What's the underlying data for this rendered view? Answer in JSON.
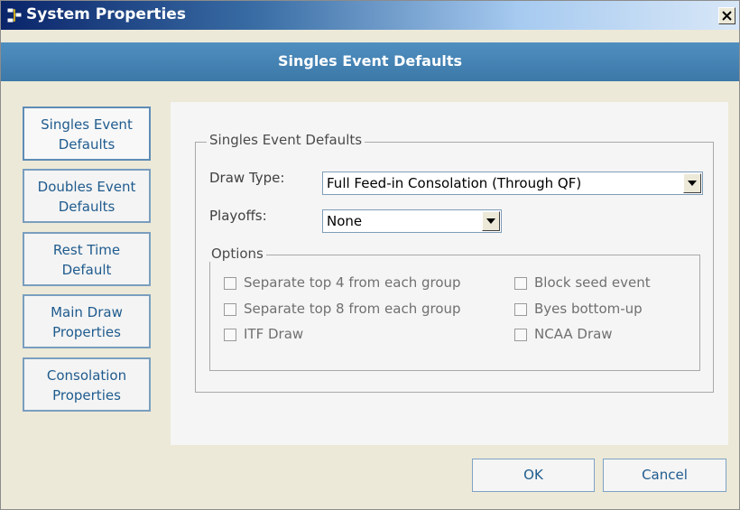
{
  "window": {
    "title": "System Properties",
    "close_symbol": "×"
  },
  "header": {
    "title": "Singles Event Defaults"
  },
  "sidebar": {
    "items": [
      {
        "line1": "Singles Event",
        "line2": "Defaults",
        "active": true
      },
      {
        "line1": "Doubles Event",
        "line2": "Defaults",
        "active": false
      },
      {
        "line1": "Rest Time",
        "line2": "Default",
        "active": false
      },
      {
        "line1": "Main Draw",
        "line2": "Properties",
        "active": false
      },
      {
        "line1": "Consolation",
        "line2": "Properties",
        "active": false
      }
    ]
  },
  "main": {
    "group_title": "Singles Event Defaults",
    "draw_type": {
      "label": "Draw Type:",
      "value": "Full Feed-in Consolation (Through QF)"
    },
    "playoffs": {
      "label": "Playoffs:",
      "value": "None"
    },
    "options": {
      "title": "Options",
      "checkboxes": [
        {
          "label": "Separate top 4 from each group",
          "checked": false
        },
        {
          "label": "Separate top 8 from each group",
          "checked": false
        },
        {
          "label": "ITF Draw",
          "checked": false
        },
        {
          "label": "Block seed event",
          "checked": false
        },
        {
          "label": "Byes bottom-up",
          "checked": false
        },
        {
          "label": "NCAA Draw",
          "checked": false
        }
      ]
    }
  },
  "footer": {
    "ok_label": "OK",
    "cancel_label": "Cancel"
  },
  "colors": {
    "header_band": "#3c78a8",
    "nav_text": "#1f5b8e"
  }
}
